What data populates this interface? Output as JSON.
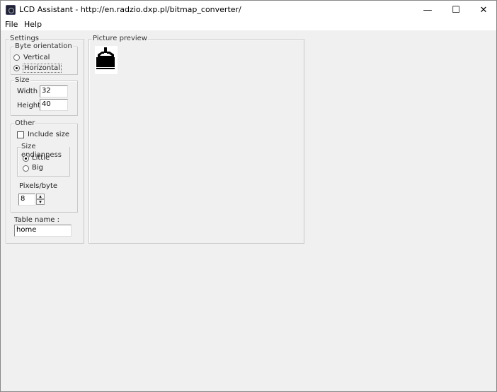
{
  "window": {
    "title": "LCD Assistant -  http://en.radzio.dxp.pl/bitmap_converter/",
    "minimize": "—",
    "maximize": "☐",
    "close": "✕"
  },
  "menu": [
    "File",
    "Help"
  ],
  "settings": {
    "label": "Settings",
    "byte_orientation": {
      "label": "Byte orientation",
      "options": [
        "Vertical",
        "Horizontal"
      ],
      "selected": "Horizontal"
    },
    "size": {
      "label": "Size",
      "width_label": "Width",
      "width": "32",
      "height_label": "Height",
      "height": "40"
    },
    "other": {
      "label": "Other",
      "include_size": "Include size",
      "include_size_checked": false,
      "endianness": {
        "label": "Size endianness",
        "options": [
          "Little",
          "Big"
        ],
        "selected": "Little"
      },
      "pixels_label": "Pixels/byte",
      "pixels": "8",
      "up": "▴",
      "down": "▾"
    },
    "table_name_label": "Table name :",
    "table_name": "home"
  },
  "preview": {
    "label": "Picture preview"
  }
}
